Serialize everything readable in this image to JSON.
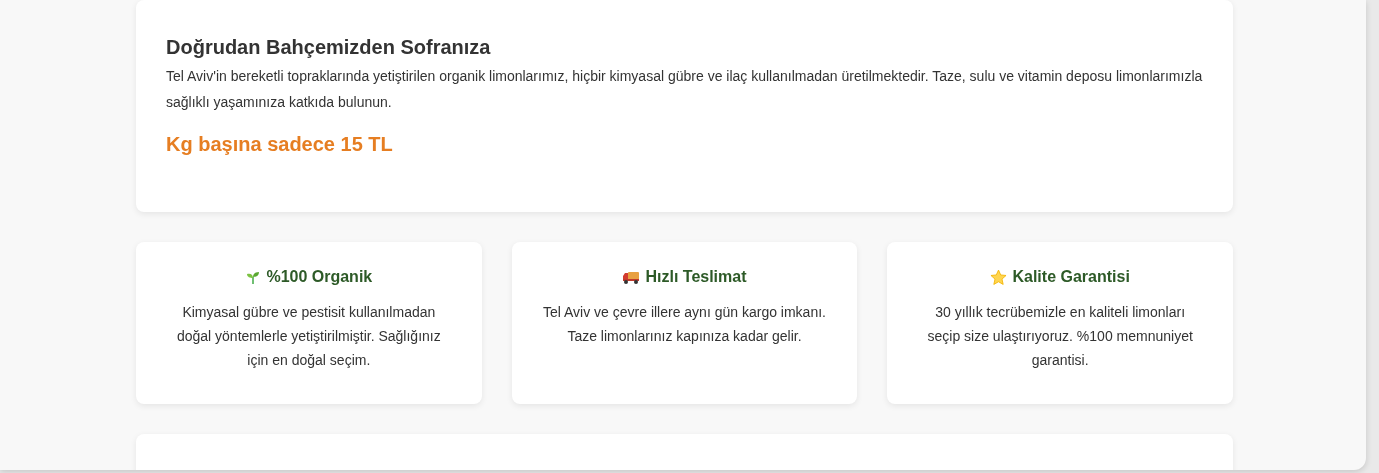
{
  "intro": {
    "title": "Doğrudan Bahçemizden Sofranıza",
    "text": "Tel Aviv'in bereketli topraklarında yetiştirilen organik limonlarımız, hiçbir kimyasal gübre ve ilaç kullanılmadan üretilmektedir. Taze, sulu ve vitamin deposu limonlarımızla sağlıklı yaşamınıza katkıda bulunun.",
    "price": "Kg başına sadece 15 TL"
  },
  "features": [
    {
      "title": "%100 Organik",
      "text": "Kimyasal gübre ve pestisit kullanılmadan doğal yöntemlerle yetiştirilmiştir. Sağlığınız için en doğal seçim."
    },
    {
      "title": "Hızlı Teslimat",
      "text": "Tel Aviv ve çevre illere aynı gün kargo imkanı. Taze limonlarınız kapınıza kadar gelir."
    },
    {
      "title": "Kalite Garantisi",
      "text": "30 yıllık tecrübemizle en kaliteli limonları seçip size ulaştırıyoruz. %100 memnuniyet garantisi."
    }
  ]
}
